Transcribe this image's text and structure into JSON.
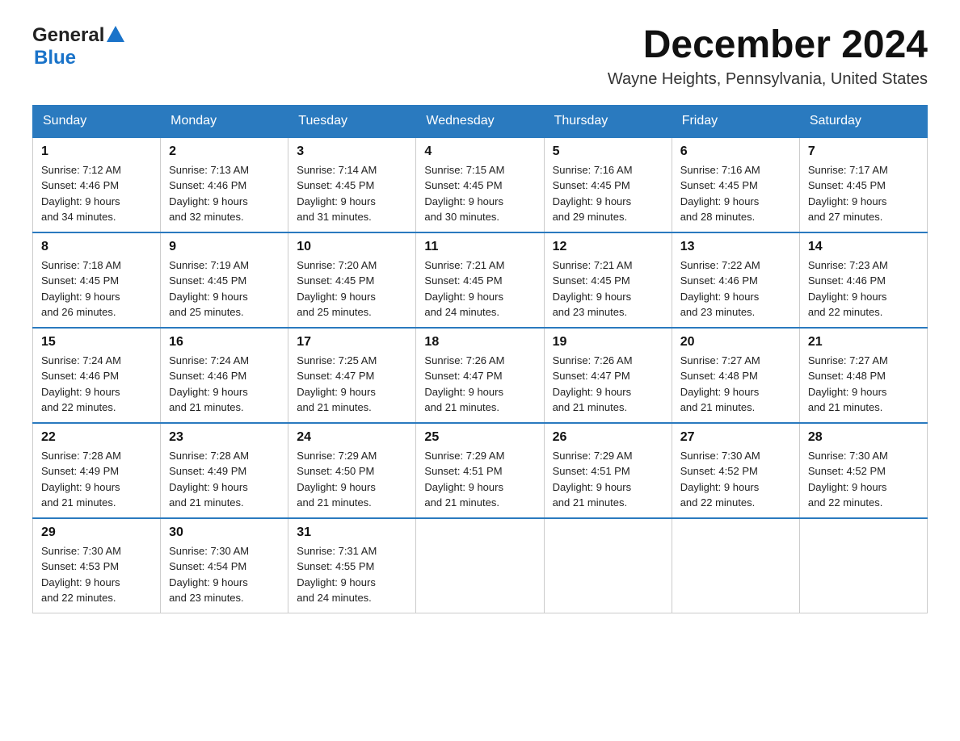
{
  "header": {
    "logo_general": "General",
    "logo_blue": "Blue",
    "month_title": "December 2024",
    "location": "Wayne Heights, Pennsylvania, United States"
  },
  "days_of_week": [
    "Sunday",
    "Monday",
    "Tuesday",
    "Wednesday",
    "Thursday",
    "Friday",
    "Saturday"
  ],
  "weeks": [
    [
      {
        "day": "1",
        "sunrise": "7:12 AM",
        "sunset": "4:46 PM",
        "daylight": "9 hours and 34 minutes."
      },
      {
        "day": "2",
        "sunrise": "7:13 AM",
        "sunset": "4:46 PM",
        "daylight": "9 hours and 32 minutes."
      },
      {
        "day": "3",
        "sunrise": "7:14 AM",
        "sunset": "4:45 PM",
        "daylight": "9 hours and 31 minutes."
      },
      {
        "day": "4",
        "sunrise": "7:15 AM",
        "sunset": "4:45 PM",
        "daylight": "9 hours and 30 minutes."
      },
      {
        "day": "5",
        "sunrise": "7:16 AM",
        "sunset": "4:45 PM",
        "daylight": "9 hours and 29 minutes."
      },
      {
        "day": "6",
        "sunrise": "7:16 AM",
        "sunset": "4:45 PM",
        "daylight": "9 hours and 28 minutes."
      },
      {
        "day": "7",
        "sunrise": "7:17 AM",
        "sunset": "4:45 PM",
        "daylight": "9 hours and 27 minutes."
      }
    ],
    [
      {
        "day": "8",
        "sunrise": "7:18 AM",
        "sunset": "4:45 PM",
        "daylight": "9 hours and 26 minutes."
      },
      {
        "day": "9",
        "sunrise": "7:19 AM",
        "sunset": "4:45 PM",
        "daylight": "9 hours and 25 minutes."
      },
      {
        "day": "10",
        "sunrise": "7:20 AM",
        "sunset": "4:45 PM",
        "daylight": "9 hours and 25 minutes."
      },
      {
        "day": "11",
        "sunrise": "7:21 AM",
        "sunset": "4:45 PM",
        "daylight": "9 hours and 24 minutes."
      },
      {
        "day": "12",
        "sunrise": "7:21 AM",
        "sunset": "4:45 PM",
        "daylight": "9 hours and 23 minutes."
      },
      {
        "day": "13",
        "sunrise": "7:22 AM",
        "sunset": "4:46 PM",
        "daylight": "9 hours and 23 minutes."
      },
      {
        "day": "14",
        "sunrise": "7:23 AM",
        "sunset": "4:46 PM",
        "daylight": "9 hours and 22 minutes."
      }
    ],
    [
      {
        "day": "15",
        "sunrise": "7:24 AM",
        "sunset": "4:46 PM",
        "daylight": "9 hours and 22 minutes."
      },
      {
        "day": "16",
        "sunrise": "7:24 AM",
        "sunset": "4:46 PM",
        "daylight": "9 hours and 21 minutes."
      },
      {
        "day": "17",
        "sunrise": "7:25 AM",
        "sunset": "4:47 PM",
        "daylight": "9 hours and 21 minutes."
      },
      {
        "day": "18",
        "sunrise": "7:26 AM",
        "sunset": "4:47 PM",
        "daylight": "9 hours and 21 minutes."
      },
      {
        "day": "19",
        "sunrise": "7:26 AM",
        "sunset": "4:47 PM",
        "daylight": "9 hours and 21 minutes."
      },
      {
        "day": "20",
        "sunrise": "7:27 AM",
        "sunset": "4:48 PM",
        "daylight": "9 hours and 21 minutes."
      },
      {
        "day": "21",
        "sunrise": "7:27 AM",
        "sunset": "4:48 PM",
        "daylight": "9 hours and 21 minutes."
      }
    ],
    [
      {
        "day": "22",
        "sunrise": "7:28 AM",
        "sunset": "4:49 PM",
        "daylight": "9 hours and 21 minutes."
      },
      {
        "day": "23",
        "sunrise": "7:28 AM",
        "sunset": "4:49 PM",
        "daylight": "9 hours and 21 minutes."
      },
      {
        "day": "24",
        "sunrise": "7:29 AM",
        "sunset": "4:50 PM",
        "daylight": "9 hours and 21 minutes."
      },
      {
        "day": "25",
        "sunrise": "7:29 AM",
        "sunset": "4:51 PM",
        "daylight": "9 hours and 21 minutes."
      },
      {
        "day": "26",
        "sunrise": "7:29 AM",
        "sunset": "4:51 PM",
        "daylight": "9 hours and 21 minutes."
      },
      {
        "day": "27",
        "sunrise": "7:30 AM",
        "sunset": "4:52 PM",
        "daylight": "9 hours and 22 minutes."
      },
      {
        "day": "28",
        "sunrise": "7:30 AM",
        "sunset": "4:52 PM",
        "daylight": "9 hours and 22 minutes."
      }
    ],
    [
      {
        "day": "29",
        "sunrise": "7:30 AM",
        "sunset": "4:53 PM",
        "daylight": "9 hours and 22 minutes."
      },
      {
        "day": "30",
        "sunrise": "7:30 AM",
        "sunset": "4:54 PM",
        "daylight": "9 hours and 23 minutes."
      },
      {
        "day": "31",
        "sunrise": "7:31 AM",
        "sunset": "4:55 PM",
        "daylight": "9 hours and 24 minutes."
      },
      null,
      null,
      null,
      null
    ]
  ],
  "labels": {
    "sunrise": "Sunrise:",
    "sunset": "Sunset:",
    "daylight": "Daylight: 9 hours"
  }
}
